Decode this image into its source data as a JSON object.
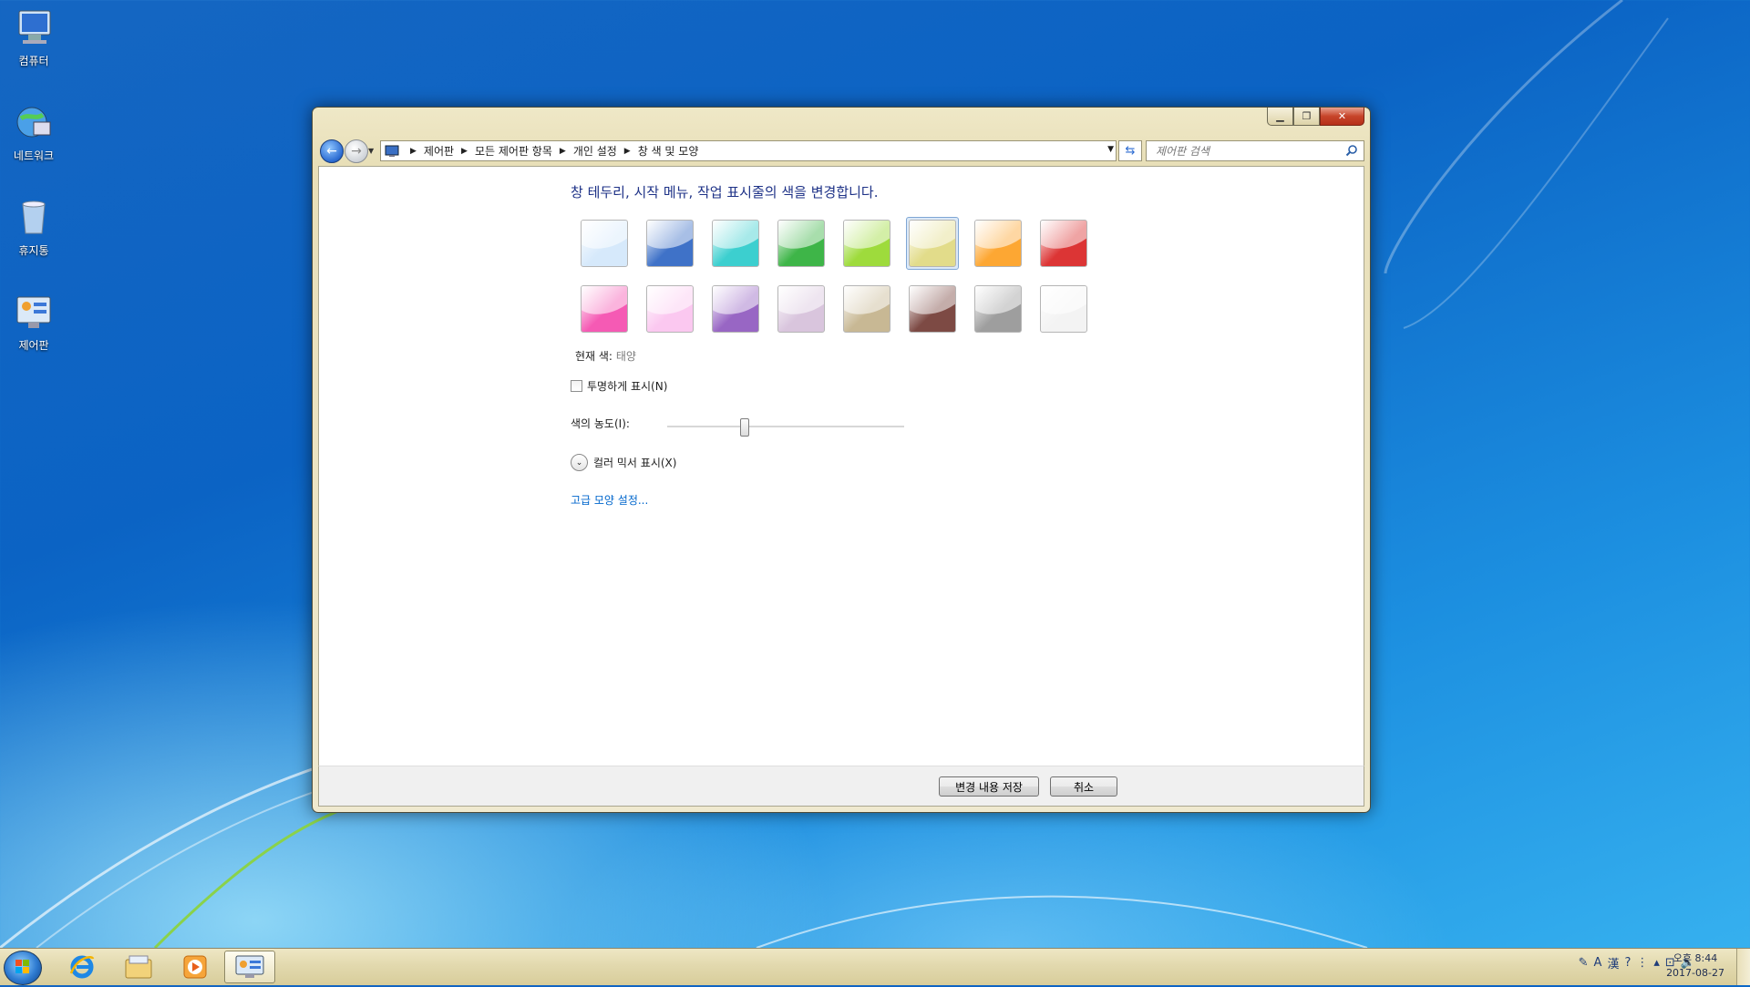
{
  "desktop": {
    "icons": [
      {
        "label": "컴퓨터",
        "icon": "computer-icon"
      },
      {
        "label": "네트워크",
        "icon": "network-icon"
      },
      {
        "label": "휴지통",
        "icon": "recycle-bin-icon"
      },
      {
        "label": "제어판",
        "icon": "control-panel-icon"
      }
    ]
  },
  "window": {
    "address": {
      "crumbs": [
        "제어판",
        "모든 제어판 항목",
        "개인 설정",
        "창 색 및 모양"
      ]
    },
    "search": {
      "placeholder": "제어판 검색"
    },
    "heading": "창 테두리, 시작 메뉴, 작업 표시줄의 색을 변경합니다.",
    "swatches": [
      {
        "color": "#d6e9fb",
        "selected": false
      },
      {
        "color": "#3f72c8",
        "selected": false
      },
      {
        "color": "#3ccfcf",
        "selected": false
      },
      {
        "color": "#3eb548",
        "selected": false
      },
      {
        "color": "#9edb3c",
        "selected": false
      },
      {
        "color": "#e2dc8a",
        "selected": true
      },
      {
        "color": "#fda733",
        "selected": false
      },
      {
        "color": "#dc3535",
        "selected": false
      },
      {
        "color": "#f55ab4",
        "selected": false
      },
      {
        "color": "#fbc8f0",
        "selected": false
      },
      {
        "color": "#9866c4",
        "selected": false
      },
      {
        "color": "#d9c5dd",
        "selected": false
      },
      {
        "color": "#c8b894",
        "selected": false
      },
      {
        "color": "#7d4a44",
        "selected": false
      },
      {
        "color": "#9e9e9e",
        "selected": false
      },
      {
        "color": "#f3f3f3",
        "selected": false
      }
    ],
    "current_color": {
      "label": "현재 색:",
      "value": "태양"
    },
    "transparency": {
      "label": "투명하게 표시(N)",
      "checked": false
    },
    "intensity": {
      "label": "색의 농도(I):",
      "level": 0.32
    },
    "mixer_label": "컬러 믹서 표시(X)",
    "advanced_link": "고급 모양 설정...",
    "buttons": {
      "save": "변경 내용 저장",
      "cancel": "취소"
    }
  },
  "taskbar": {
    "pinned": [
      "internet-explorer-icon",
      "file-explorer-icon",
      "media-player-icon",
      "control-panel-icon"
    ],
    "tray": {
      "ime_a": "A",
      "ime_hanja": "漢"
    },
    "clock": {
      "time": "오후 8:44",
      "date": "2017-08-27"
    }
  }
}
